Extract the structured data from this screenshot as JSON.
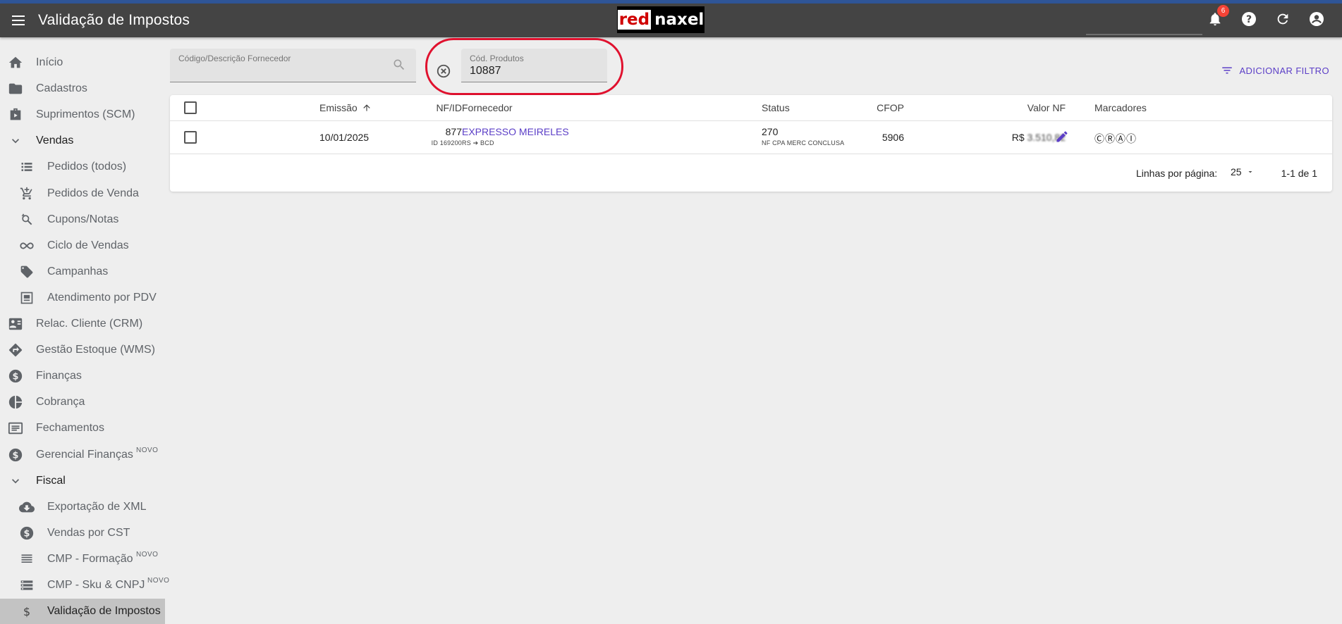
{
  "appbar": {
    "title": "Validação de Impostos",
    "logo_red": "red",
    "logo_white": "naxel",
    "notification_count": "6"
  },
  "sidebar": {
    "items": [
      {
        "label": "Início",
        "icon": "home-icon",
        "type": "top"
      },
      {
        "label": "Cadastros",
        "icon": "folder-icon",
        "type": "top"
      },
      {
        "label": "Suprimentos (SCM)",
        "icon": "suitcase-icon",
        "type": "top"
      },
      {
        "label": "Vendas",
        "icon": "chevron-down-icon",
        "type": "group"
      },
      {
        "label": "Pedidos (todos)",
        "icon": "list-icon",
        "type": "sub"
      },
      {
        "label": "Pedidos de Venda",
        "icon": "cart-icon",
        "type": "sub"
      },
      {
        "label": "Cupons/Notas",
        "icon": "search-sync-icon",
        "type": "sub"
      },
      {
        "label": "Ciclo de Vendas",
        "icon": "infinity-icon",
        "type": "sub"
      },
      {
        "label": "Campanhas",
        "icon": "tag-icon",
        "type": "sub"
      },
      {
        "label": "Atendimento por PDV",
        "icon": "pdv-icon",
        "type": "sub"
      },
      {
        "label": "Relac. Cliente (CRM)",
        "icon": "contact-card-icon",
        "type": "top"
      },
      {
        "label": "Gestão Estoque (WMS)",
        "icon": "directions-icon",
        "type": "top"
      },
      {
        "label": "Finanças",
        "icon": "dollar-icon",
        "type": "top"
      },
      {
        "label": "Cobrança",
        "icon": "pie-chart-icon",
        "type": "top"
      },
      {
        "label": "Fechamentos",
        "icon": "receipt-icon",
        "type": "top"
      },
      {
        "label": "Gerencial Finanças",
        "icon": "dollar-icon",
        "type": "top",
        "badge": "NOVO"
      },
      {
        "label": "Fiscal",
        "icon": "chevron-down-icon",
        "type": "group"
      },
      {
        "label": "Exportação de XML",
        "icon": "cloud-download-icon",
        "type": "sub"
      },
      {
        "label": "Vendas por CST",
        "icon": "dollar-icon",
        "type": "sub"
      },
      {
        "label": "CMP - Formação",
        "icon": "lines-icon",
        "type": "sub",
        "badge": "NOVO"
      },
      {
        "label": "CMP - Sku & CNPJ",
        "icon": "storage-icon",
        "type": "sub",
        "badge": "NOVO"
      },
      {
        "label": "Validação de Impostos",
        "icon": "dollar-sign-icon",
        "type": "sub",
        "active": true
      }
    ]
  },
  "filters": {
    "fornecedor": {
      "label": "Código/Descrição Fornecedor",
      "value": ""
    },
    "produtos": {
      "label": "Cód. Produtos",
      "value": "10887"
    },
    "add_filter_label": "ADICIONAR FILTRO"
  },
  "table": {
    "headers": {
      "nf": "NF/ID",
      "emissao": "Emissão",
      "fornecedor": "Fornecedor",
      "cfop": "CFOP",
      "status": "Status",
      "valor": "Valor NF",
      "marcadores": "Marcadores"
    },
    "rows": [
      {
        "nf": "877",
        "id": "ID 169200",
        "emissao": "10/01/2025",
        "fornecedor": "EXPRESSO MEIRELES",
        "rota": "RS ➔ BCD",
        "cfop": "5906",
        "status_code": "270",
        "status_text": "NF CPA MERC CONCLUSA",
        "valor_prefix": "R$",
        "valor": "3.510,82",
        "marcadores": "ⒸⓇⒶⒾ"
      }
    ],
    "footer": {
      "rows_per_page_label": "Linhas por página:",
      "rows_per_page": "25",
      "range": "1-1 de 1"
    }
  }
}
